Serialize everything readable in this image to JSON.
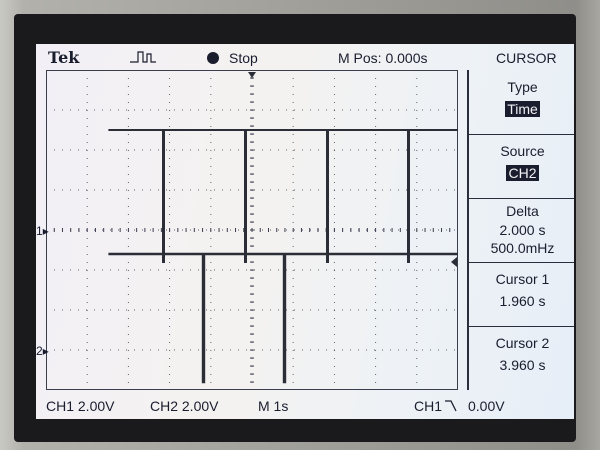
{
  "header": {
    "brand": "Tek",
    "trigger_icon": "trigger-pulse-icon",
    "run_state": "Stop",
    "m_pos": "M Pos: 0.000s",
    "menu_title": "CURSOR"
  },
  "menu": {
    "type": {
      "label": "Type",
      "value": "Time"
    },
    "source": {
      "label": "Source",
      "value": "CH2"
    },
    "delta": {
      "label": "Delta",
      "value": "2.000 s",
      "value2": "500.0mHz"
    },
    "cursor1": {
      "label": "Cursor 1",
      "value": "1.960 s"
    },
    "cursor2": {
      "label": "Cursor 2",
      "value": "3.960 s"
    }
  },
  "markers": {
    "ch1": "1",
    "ch2": "2"
  },
  "footer": {
    "ch1_scale": "CH1 2.00V",
    "ch2_scale": "CH2 2.00V",
    "timebase": "M 1s",
    "trigger": "CH1",
    "trigger_slope_icon": "falling-edge-icon",
    "trigger_level": "0.00V"
  },
  "colors": {
    "trace": "#2b2e36",
    "text": "#1a1d2e",
    "grid_dots": "#3a3d4c"
  }
}
